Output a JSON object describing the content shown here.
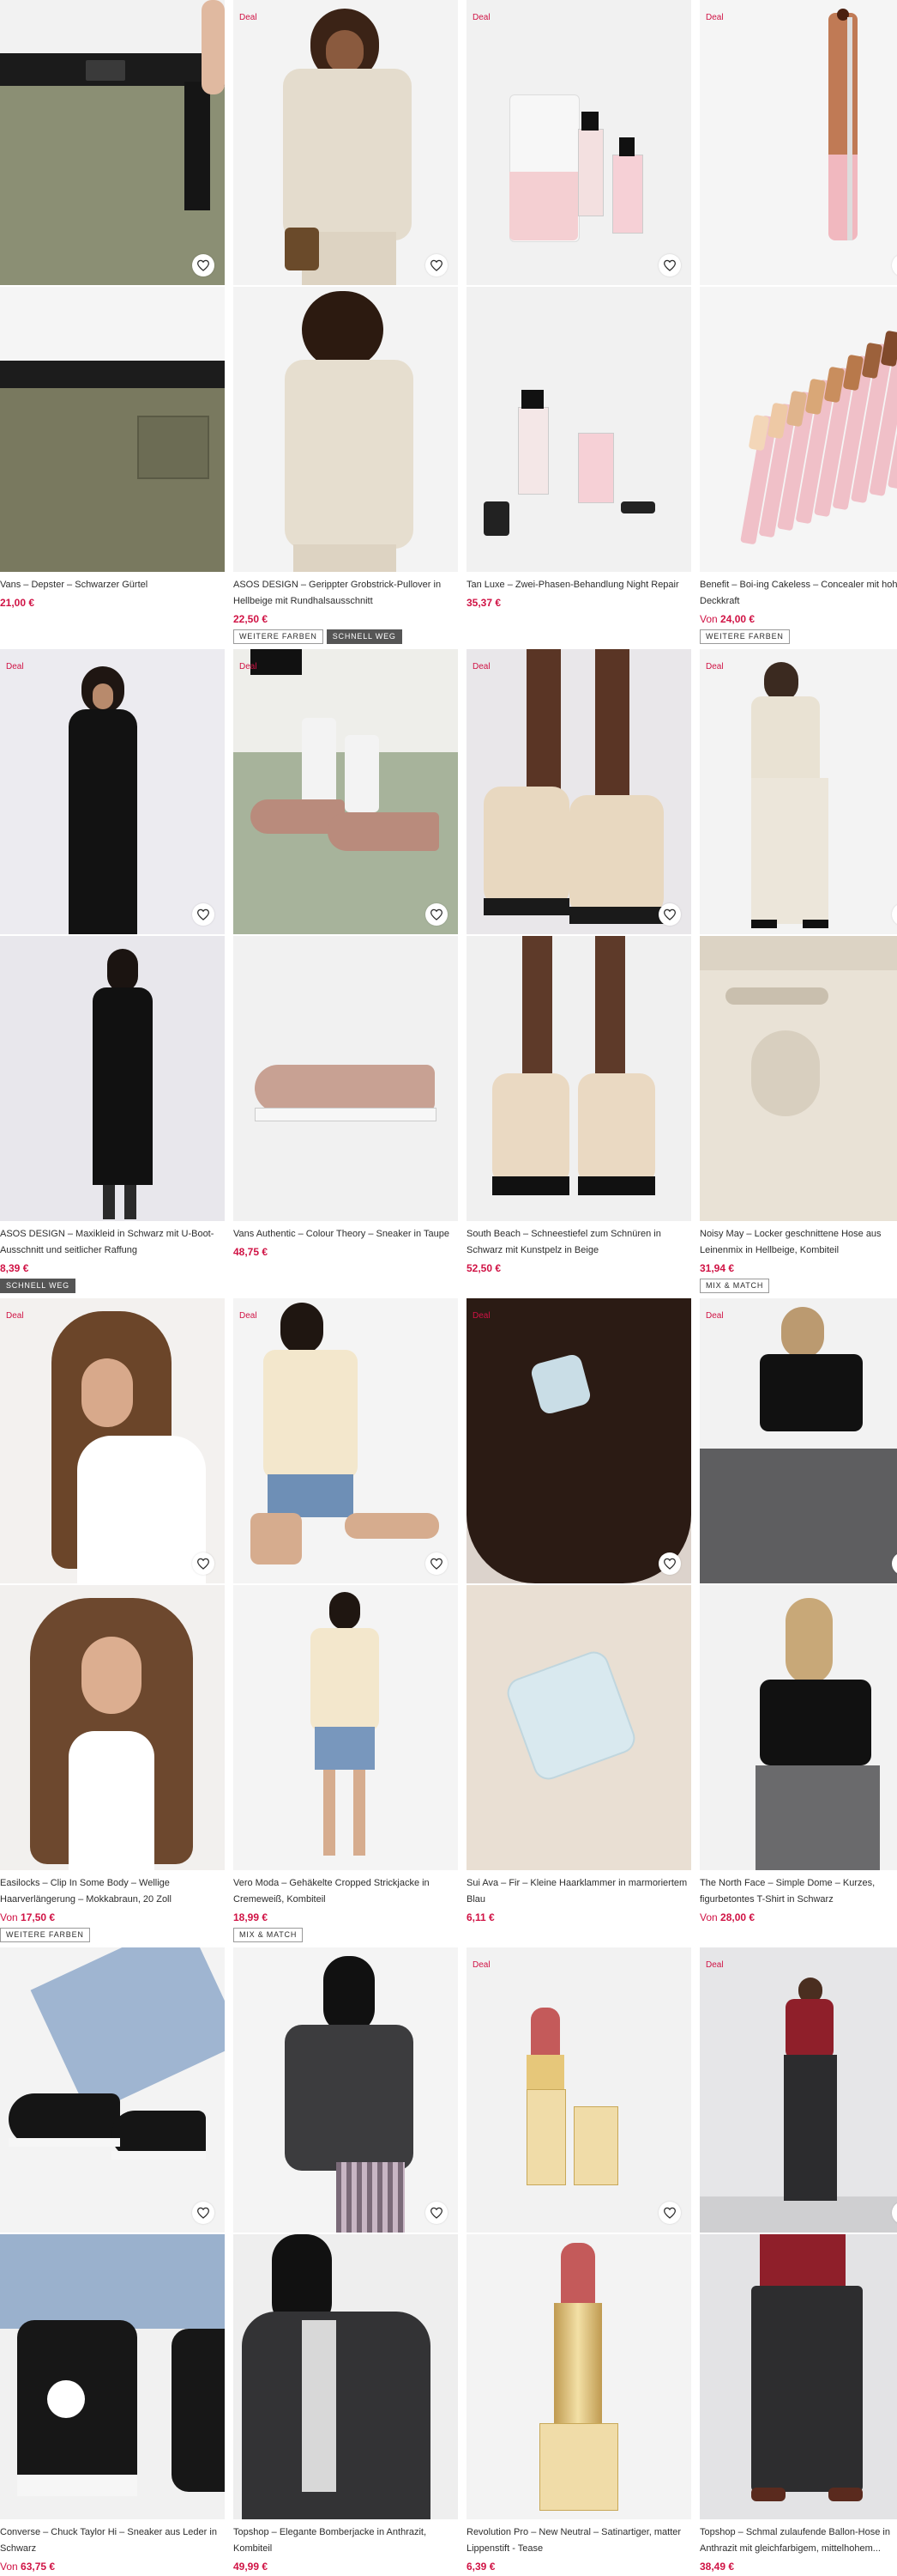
{
  "deal_label": "Deal",
  "rows": [
    [
      {
        "name": "Vans – Depster – Schwarzer Gürtel",
        "price": "21,00 €",
        "from": "",
        "deal": false,
        "badges": []
      },
      {
        "name": "ASOS DESIGN – Gerippter Grobstrick-Pullover in Hellbeige mit Rundhalsausschnitt",
        "price": "22,50 €",
        "from": "",
        "deal": true,
        "badges": [
          {
            "label": "WEITERE FARBEN",
            "style": "outline"
          },
          {
            "label": "SCHNELL WEG",
            "style": "dark"
          }
        ]
      },
      {
        "name": "Tan Luxe – Zwei-Phasen-Behandlung Night Repair",
        "price": "35,37 €",
        "from": "",
        "deal": true,
        "badges": []
      },
      {
        "name": "Benefit – Boi-ing Cakeless – Concealer mit hoher Deckkraft",
        "price": "24,00 €",
        "from": "Von",
        "deal": true,
        "badges": [
          {
            "label": "WEITERE FARBEN",
            "style": "outline"
          }
        ]
      }
    ],
    [
      {
        "name": "ASOS DESIGN – Maxikleid in Schwarz mit U-Boot-Ausschnitt und seitlicher Raffung",
        "price": "8,39 €",
        "from": "",
        "deal": true,
        "badges": [
          {
            "label": "SCHNELL WEG",
            "style": "dark"
          }
        ]
      },
      {
        "name": "Vans Authentic – Colour Theory – Sneaker in Taupe",
        "price": "48,75 €",
        "from": "",
        "deal": true,
        "badges": []
      },
      {
        "name": "South Beach – Schneestiefel zum Schnüren in Schwarz mit Kunstpelz in Beige",
        "price": "52,50 €",
        "from": "",
        "deal": true,
        "badges": []
      },
      {
        "name": "Noisy May – Locker geschnittene Hose aus Leinenmix in Hellbeige, Kombiteil",
        "price": "31,94 €",
        "from": "",
        "deal": true,
        "badges": [
          {
            "label": "MIX & MATCH",
            "style": "outline"
          }
        ]
      }
    ],
    [
      {
        "name": "Easilocks – Clip In Some Body – Wellige Haarverlängerung – Mokkabraun, 20 Zoll",
        "price": "17,50 €",
        "from": "Von",
        "deal": true,
        "badges": [
          {
            "label": "WEITERE FARBEN",
            "style": "outline"
          }
        ]
      },
      {
        "name": "Vero Moda – Gehäkelte Cropped Strickjacke in Cremeweiß, Kombiteil",
        "price": "18,99 €",
        "from": "",
        "deal": true,
        "badges": [
          {
            "label": "MIX & MATCH",
            "style": "outline"
          }
        ]
      },
      {
        "name": "Sui Ava – Fir – Kleine Haarklammer in marmoriertem Blau",
        "price": "6,11 €",
        "from": "",
        "deal": true,
        "badges": []
      },
      {
        "name": "The North Face – Simple Dome – Kurzes, figurbetontes T-Shirt in Schwarz",
        "price": "28,00 €",
        "from": "Von",
        "deal": true,
        "badges": []
      }
    ],
    [
      {
        "name": "Converse – Chuck Taylor Hi – Sneaker aus Leder in Schwarz",
        "price": "63,75 €",
        "from": "Von",
        "deal": false,
        "badges": []
      },
      {
        "name": "Topshop – Elegante Bomberjacke in Anthrazit, Kombiteil",
        "price": "49,99 €",
        "from": "",
        "deal": false,
        "badges": []
      },
      {
        "name": "Revolution Pro – New Neutral – Satinartiger, matter Lippenstift - Tease",
        "price": "6,39 €",
        "from": "",
        "deal": true,
        "badges": []
      },
      {
        "name": "Topshop – Schmal zulaufende Ballon-Hose in Anthrazit mit gleichfarbigem, mittelhohem...",
        "price": "38,49 €",
        "from": "",
        "deal": true,
        "badges": []
      }
    ]
  ],
  "colors": {
    "price": "#d01345",
    "deal": "#d01345",
    "text": "#2d2d2d",
    "badge_dark": "#555555"
  },
  "icons": {
    "favorite": "heart-outline-icon"
  }
}
